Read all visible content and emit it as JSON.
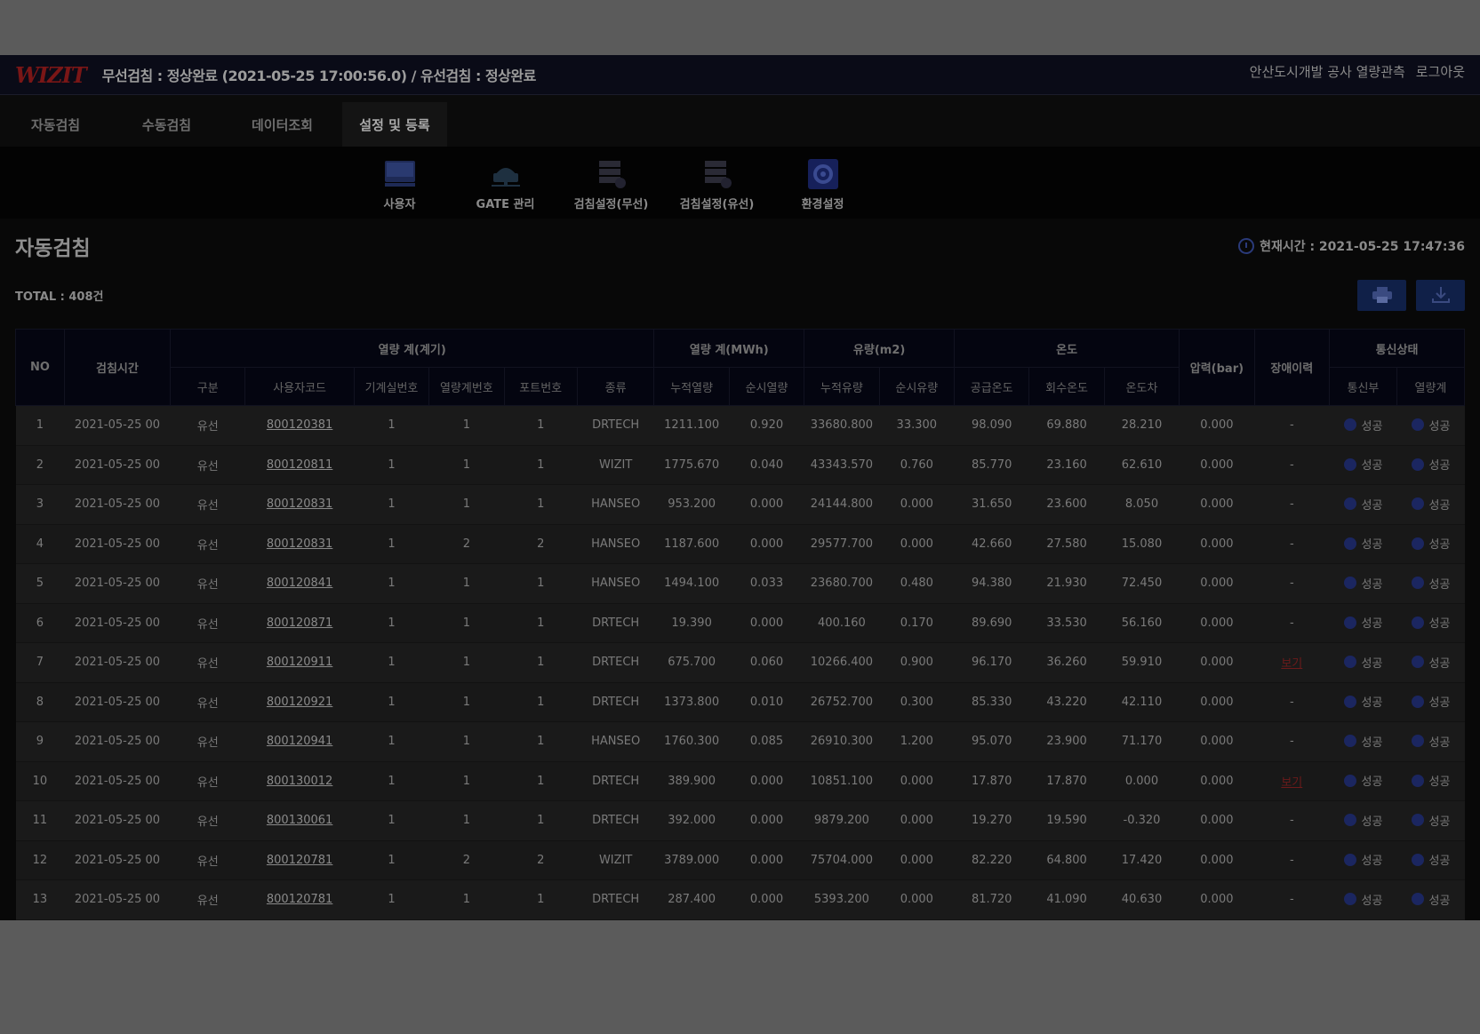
{
  "header": {
    "logo": "WIZIT",
    "status": "무선검침 : 정상완료 (2021-05-25 17:00:56.0) / 유선검침 : 정상완료",
    "site": "안산도시개발 공사 열량관측",
    "logout": "로그아웃"
  },
  "tabs": [
    "자동검침",
    "수동검침",
    "데이터조회",
    "설정 및 등록"
  ],
  "submenu": [
    "사용자",
    "GATE 관리",
    "검침설정(무선)",
    "검침설정(유선)",
    "환경설정"
  ],
  "page": {
    "title": "자동검침",
    "clock": "현재시간 : 2021-05-25 17:47:36",
    "total": "TOTAL : 408건"
  },
  "table": {
    "group_headers": {
      "no": "NO",
      "time": "검침시간",
      "meter": "열량 계(계기)",
      "heat": "열량 계(MWh)",
      "flow": "유량(m2)",
      "temp": "온도",
      "pressure": "압력(bar)",
      "fault": "장애이력",
      "comm": "통신상태"
    },
    "sub_headers": [
      "구분",
      "사용자코드",
      "기계실번호",
      "열량계번호",
      "포트번호",
      "종류",
      "누적열량",
      "순시열량",
      "누적유량",
      "순시유량",
      "공급온도",
      "회수온도",
      "온도차",
      "통신부",
      "열량계"
    ],
    "rows": [
      {
        "no": "1",
        "time": "2021-05-25 00",
        "type": "유선",
        "code": "800120381",
        "room": "1",
        "meter": "1",
        "port": "1",
        "kind": "DRTECH",
        "cum_heat": "1211.100",
        "inst_heat": "0.920",
        "cum_flow": "33680.800",
        "inst_flow": "33.300",
        "supply": "98.090",
        "return": "69.880",
        "diff": "28.210",
        "pressure": "0.000",
        "fault": "-",
        "comm": "성공",
        "meter_state": "성공"
      },
      {
        "no": "2",
        "time": "2021-05-25 00",
        "type": "유선",
        "code": "800120811",
        "room": "1",
        "meter": "1",
        "port": "1",
        "kind": "WIZIT",
        "cum_heat": "1775.670",
        "inst_heat": "0.040",
        "cum_flow": "43343.570",
        "inst_flow": "0.760",
        "supply": "85.770",
        "return": "23.160",
        "diff": "62.610",
        "pressure": "0.000",
        "fault": "-",
        "comm": "성공",
        "meter_state": "성공"
      },
      {
        "no": "3",
        "time": "2021-05-25 00",
        "type": "유선",
        "code": "800120831",
        "room": "1",
        "meter": "1",
        "port": "1",
        "kind": "HANSEO",
        "cum_heat": "953.200",
        "inst_heat": "0.000",
        "cum_flow": "24144.800",
        "inst_flow": "0.000",
        "supply": "31.650",
        "return": "23.600",
        "diff": "8.050",
        "pressure": "0.000",
        "fault": "-",
        "comm": "성공",
        "meter_state": "성공"
      },
      {
        "no": "4",
        "time": "2021-05-25 00",
        "type": "유선",
        "code": "800120831",
        "room": "1",
        "meter": "2",
        "port": "2",
        "kind": "HANSEO",
        "cum_heat": "1187.600",
        "inst_heat": "0.000",
        "cum_flow": "29577.700",
        "inst_flow": "0.000",
        "supply": "42.660",
        "return": "27.580",
        "diff": "15.080",
        "pressure": "0.000",
        "fault": "-",
        "comm": "성공",
        "meter_state": "성공"
      },
      {
        "no": "5",
        "time": "2021-05-25 00",
        "type": "유선",
        "code": "800120841",
        "room": "1",
        "meter": "1",
        "port": "1",
        "kind": "HANSEO",
        "cum_heat": "1494.100",
        "inst_heat": "0.033",
        "cum_flow": "23680.700",
        "inst_flow": "0.480",
        "supply": "94.380",
        "return": "21.930",
        "diff": "72.450",
        "pressure": "0.000",
        "fault": "-",
        "comm": "성공",
        "meter_state": "성공"
      },
      {
        "no": "6",
        "time": "2021-05-25 00",
        "type": "유선",
        "code": "800120871",
        "room": "1",
        "meter": "1",
        "port": "1",
        "kind": "DRTECH",
        "cum_heat": "19.390",
        "inst_heat": "0.000",
        "cum_flow": "400.160",
        "inst_flow": "0.170",
        "supply": "89.690",
        "return": "33.530",
        "diff": "56.160",
        "pressure": "0.000",
        "fault": "-",
        "comm": "성공",
        "meter_state": "성공"
      },
      {
        "no": "7",
        "time": "2021-05-25 00",
        "type": "유선",
        "code": "800120911",
        "room": "1",
        "meter": "1",
        "port": "1",
        "kind": "DRTECH",
        "cum_heat": "675.700",
        "inst_heat": "0.060",
        "cum_flow": "10266.400",
        "inst_flow": "0.900",
        "supply": "96.170",
        "return": "36.260",
        "diff": "59.910",
        "pressure": "0.000",
        "fault": "보기",
        "comm": "성공",
        "meter_state": "성공"
      },
      {
        "no": "8",
        "time": "2021-05-25 00",
        "type": "유선",
        "code": "800120921",
        "room": "1",
        "meter": "1",
        "port": "1",
        "kind": "DRTECH",
        "cum_heat": "1373.800",
        "inst_heat": "0.010",
        "cum_flow": "26752.700",
        "inst_flow": "0.300",
        "supply": "85.330",
        "return": "43.220",
        "diff": "42.110",
        "pressure": "0.000",
        "fault": "-",
        "comm": "성공",
        "meter_state": "성공"
      },
      {
        "no": "9",
        "time": "2021-05-25 00",
        "type": "유선",
        "code": "800120941",
        "room": "1",
        "meter": "1",
        "port": "1",
        "kind": "HANSEO",
        "cum_heat": "1760.300",
        "inst_heat": "0.085",
        "cum_flow": "26910.300",
        "inst_flow": "1.200",
        "supply": "95.070",
        "return": "23.900",
        "diff": "71.170",
        "pressure": "0.000",
        "fault": "-",
        "comm": "성공",
        "meter_state": "성공"
      },
      {
        "no": "10",
        "time": "2021-05-25 00",
        "type": "유선",
        "code": "800130012",
        "room": "1",
        "meter": "1",
        "port": "1",
        "kind": "DRTECH",
        "cum_heat": "389.900",
        "inst_heat": "0.000",
        "cum_flow": "10851.100",
        "inst_flow": "0.000",
        "supply": "17.870",
        "return": "17.870",
        "diff": "0.000",
        "pressure": "0.000",
        "fault": "보기",
        "comm": "성공",
        "meter_state": "성공"
      },
      {
        "no": "11",
        "time": "2021-05-25 00",
        "type": "유선",
        "code": "800130061",
        "room": "1",
        "meter": "1",
        "port": "1",
        "kind": "DRTECH",
        "cum_heat": "392.000",
        "inst_heat": "0.000",
        "cum_flow": "9879.200",
        "inst_flow": "0.000",
        "supply": "19.270",
        "return": "19.590",
        "diff": "-0.320",
        "pressure": "0.000",
        "fault": "-",
        "comm": "성공",
        "meter_state": "성공"
      },
      {
        "no": "12",
        "time": "2021-05-25 00",
        "type": "유선",
        "code": "800120781",
        "room": "1",
        "meter": "2",
        "port": "2",
        "kind": "WIZIT",
        "cum_heat": "3789.000",
        "inst_heat": "0.000",
        "cum_flow": "75704.000",
        "inst_flow": "0.000",
        "supply": "82.220",
        "return": "64.800",
        "diff": "17.420",
        "pressure": "0.000",
        "fault": "-",
        "comm": "성공",
        "meter_state": "성공"
      },
      {
        "no": "13",
        "time": "2021-05-25 00",
        "type": "유선",
        "code": "800120781",
        "room": "1",
        "meter": "1",
        "port": "1",
        "kind": "DRTECH",
        "cum_heat": "287.400",
        "inst_heat": "0.000",
        "cum_flow": "5393.200",
        "inst_flow": "0.000",
        "supply": "81.720",
        "return": "41.090",
        "diff": "40.630",
        "pressure": "0.000",
        "fault": "-",
        "comm": "성공",
        "meter_state": "성공"
      }
    ]
  },
  "colors": {
    "overlay": "#5b5b5b",
    "button": "#102048",
    "dot": "#1b2660",
    "fault_link": "#6c1a1a"
  }
}
